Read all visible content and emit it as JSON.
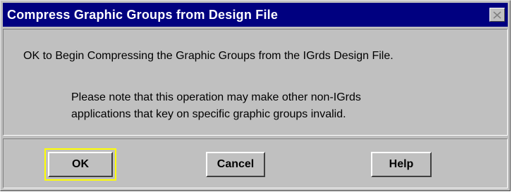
{
  "dialog": {
    "title": "Compress Graphic Groups from Design File",
    "close_icon": "close-icon"
  },
  "message": {
    "main": "OK to Begin Compressing the Graphic Groups from the IGrds Design File.",
    "note_line1": "Please note that this operation may make other non-IGrds",
    "note_line2": "applications that key on specific graphic groups invalid."
  },
  "buttons": {
    "ok_label": "OK",
    "cancel_label": "Cancel",
    "help_label": "Help"
  },
  "colors": {
    "title_bar": "#000080",
    "dialog_face": "#c0c0c0",
    "focus_highlight": "#ffff00"
  }
}
